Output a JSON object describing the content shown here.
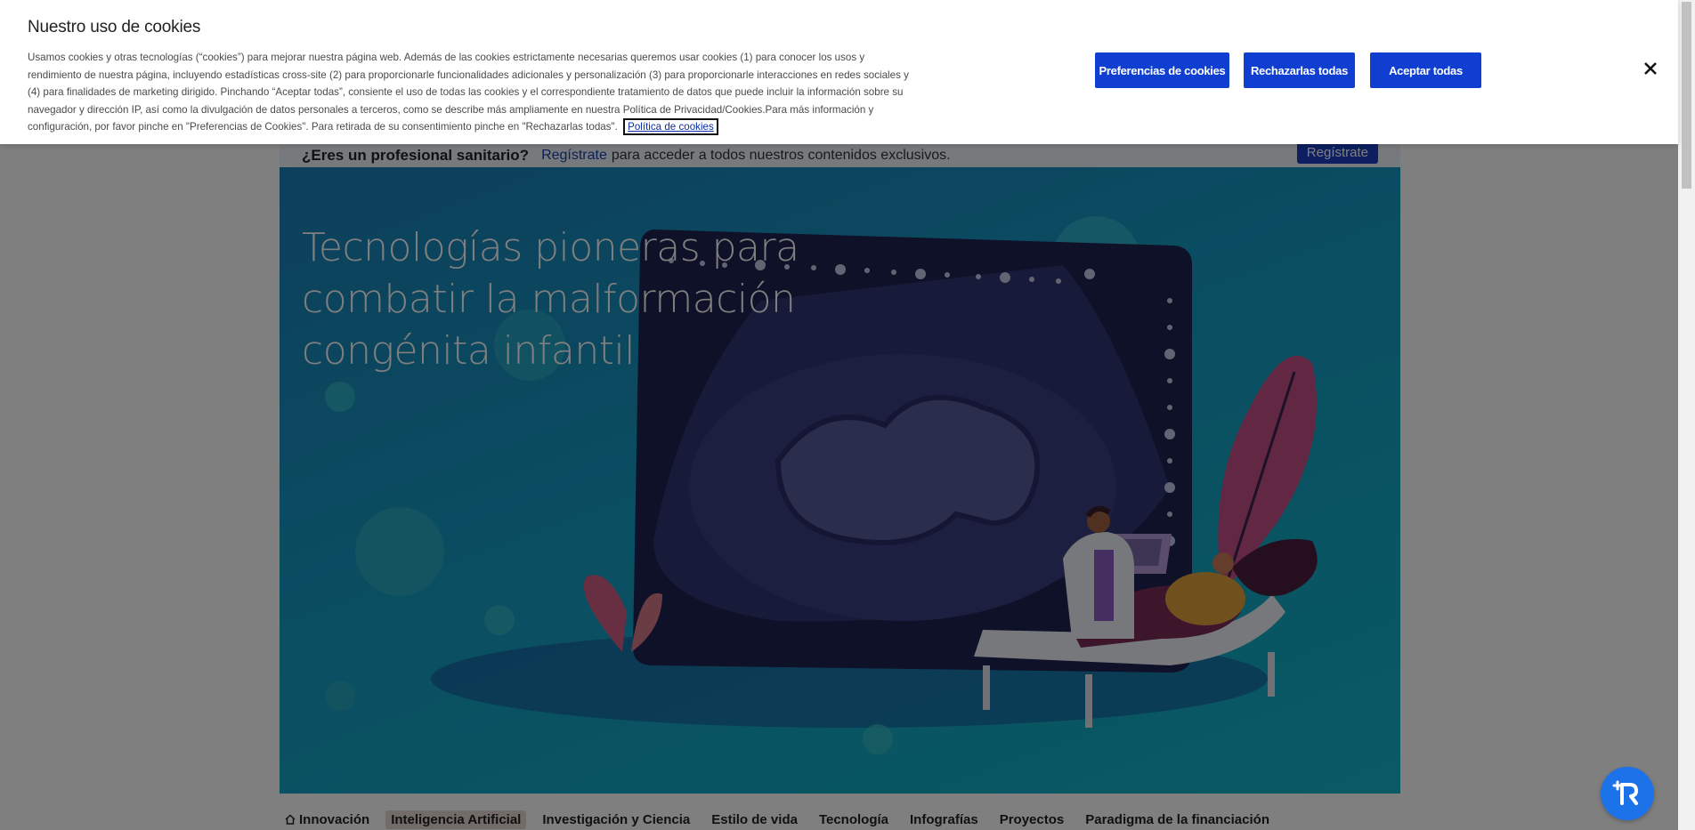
{
  "cookie_banner": {
    "title": "Nuestro uso de cookies",
    "body": "Usamos cookies y otras tecnologías (“cookies”) para mejorar nuestra página web. Además de las cookies estrictamente necesarias queremos usar cookies (1) para conocer los usos y rendimiento de nuestra página, incluyendo estadísticas cross-site (2) para proporcionarle funcionalidades adicionales y personalización (3) para proporcionarle interacciones en redes sociales y (4) para finalidades de marketing dirigido. Pinchando “Aceptar todas”, consiente el uso de todas las cookies y el correspondiente tratamiento de datos que puede incluir la información sobre su navegador y dirección IP, así como la divulgación de datos personales a terceros, como se describe más ampliamente en nuestra Política de Privacidad/Cookies.Para más información y configuración, por favor pinche en \"Preferencias de Cookies\". Para retirada de su consentimiento pinche en \"Rechazarlas todas\".",
    "policy_link": "Política de cookies",
    "buttons": {
      "preferences": "Preferencias de cookies",
      "reject_all": "Rechazarlas todas",
      "accept_all": "Aceptar todas"
    },
    "close_icon": "close-icon",
    "accent_color": "#0f3ed1"
  },
  "pro_bar": {
    "question": "¿Eres un profesional sanitario?",
    "link": "Regístrate",
    "rest": "para acceder a todos nuestros contenidos exclusivos.",
    "button": "Regístrate"
  },
  "hero": {
    "title": "Tecnologías pioneras para combatir la malformación congénita infantil"
  },
  "nav": {
    "items": [
      {
        "label": "Innovación",
        "icon": "home-icon"
      },
      {
        "label": "Inteligencia Artificial",
        "active": true
      },
      {
        "label": "Investigación y Ciencia"
      },
      {
        "label": "Estilo de vida"
      },
      {
        "label": "Tecnología"
      },
      {
        "label": "Infografías"
      },
      {
        "label": "Proyectos"
      },
      {
        "label": "Paradigma de la financiación"
      }
    ]
  },
  "floating_button": {
    "icon": "accessibility-icon"
  }
}
